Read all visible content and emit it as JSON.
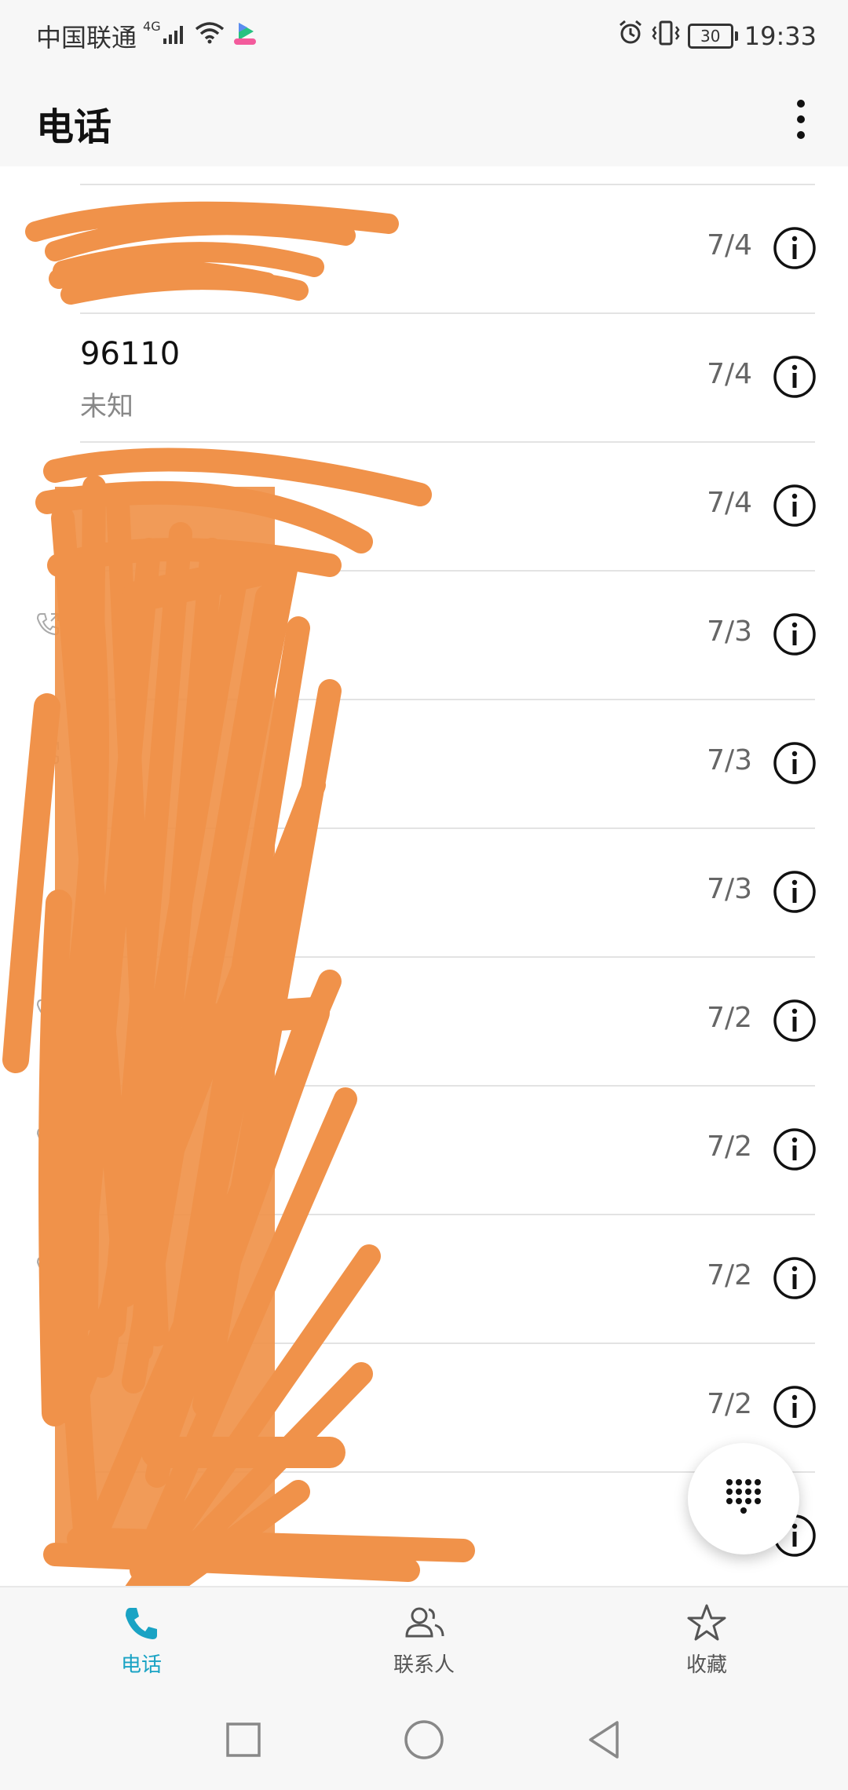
{
  "status_bar": {
    "carrier": "中国联通",
    "network": "4G",
    "battery": "30",
    "time": "19:33"
  },
  "app_bar": {
    "title": "电话"
  },
  "call_log": [
    {
      "name": "",
      "sub": "",
      "date": "7/4"
    },
    {
      "name": "96110",
      "sub": "未知",
      "date": "7/4"
    },
    {
      "name": "",
      "sub": "",
      "date": "7/4"
    },
    {
      "name": "",
      "sub": "",
      "date": "7/3"
    },
    {
      "name": "",
      "sub": "",
      "date": "7/3"
    },
    {
      "name": "",
      "sub": "",
      "date": "7/3"
    },
    {
      "name": "",
      "sub": "",
      "date": "7/2"
    },
    {
      "name": "",
      "sub": "",
      "date": "7/2"
    },
    {
      "name": "",
      "sub": "",
      "date": "7/2"
    },
    {
      "name": "",
      "sub": "",
      "date": "7/2"
    },
    {
      "name": "",
      "sub": "",
      "date": ""
    }
  ],
  "bottom_nav": {
    "phone": "电话",
    "contacts": "联系人",
    "favorites": "收藏"
  },
  "icons": {
    "more": "more-vert-icon",
    "info": "info-icon",
    "dialpad": "dialpad-icon",
    "phone": "phone-icon",
    "contacts": "contacts-icon",
    "favorites": "star-icon",
    "recents": "square-icon",
    "home": "circle-icon",
    "back": "triangle-back-icon"
  },
  "colors": {
    "accent": "#1aa3c4",
    "redaction": "#f0924a"
  }
}
